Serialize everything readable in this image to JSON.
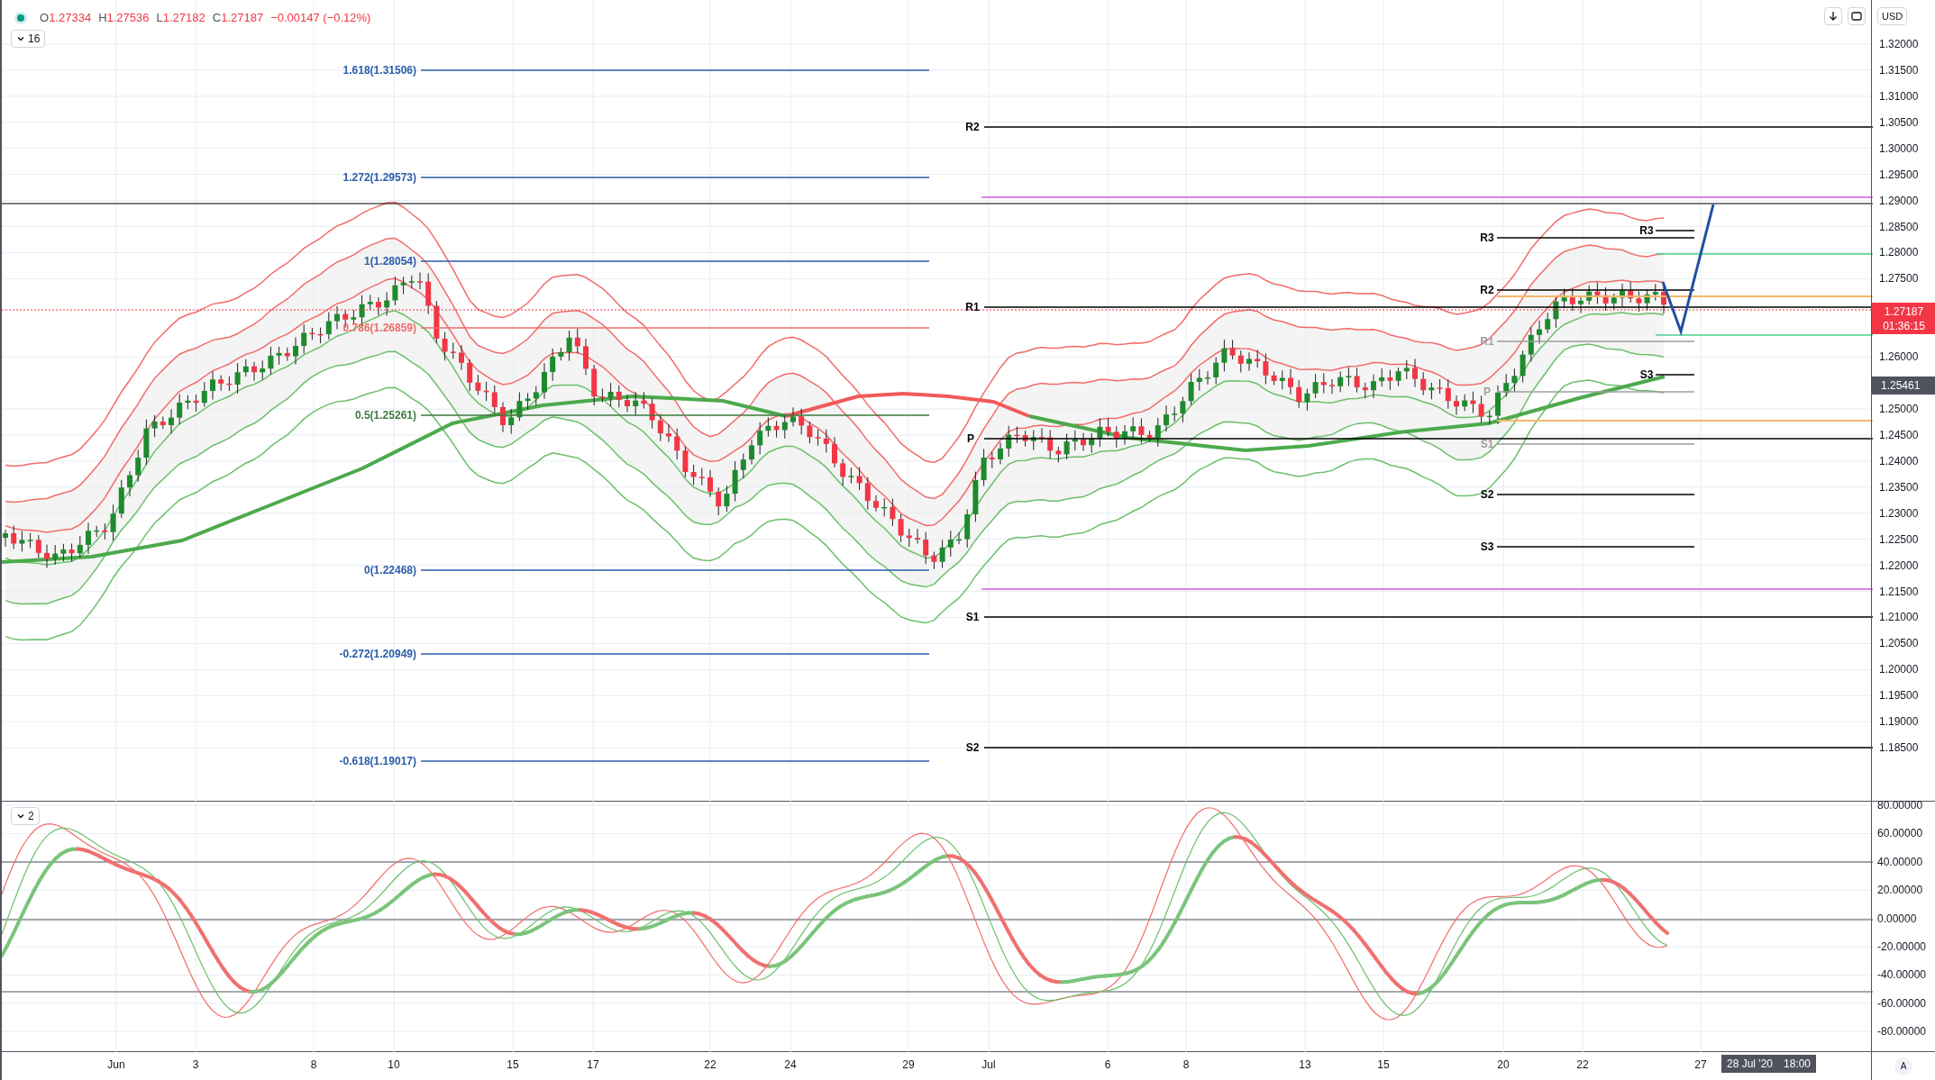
{
  "header": {
    "ohlc": [
      {
        "label": "O",
        "value": "1.27334"
      },
      {
        "label": "H",
        "value": "1.27536"
      },
      {
        "label": "L",
        "value": "1.27182"
      },
      {
        "label": "C",
        "value": "1.27187"
      }
    ],
    "change": "−0.00147 (−0.12%)"
  },
  "main_pane": {
    "collapse_count": "16"
  },
  "toolbar": {
    "currency": "USD"
  },
  "price_axis": {
    "ticks": [
      "1.32000",
      "1.31500",
      "1.31000",
      "1.30500",
      "1.30000",
      "1.29500",
      "1.29000",
      "1.28500",
      "1.28000",
      "1.27500",
      "1.26000",
      "1.25000",
      "1.24500",
      "1.24000",
      "1.23500",
      "1.23000",
      "1.22500",
      "1.22000",
      "1.21500",
      "1.21000",
      "1.20500",
      "1.20000",
      "1.19500",
      "1.19000",
      "1.18500"
    ],
    "last_price": "1.27187",
    "countdown": "01:36:15",
    "crosshair_price": "1.25461"
  },
  "fib_levels": [
    {
      "label": "1.618(1.31506)",
      "color": "#2a5caa"
    },
    {
      "label": "1.272(1.29573)",
      "color": "#2a5caa"
    },
    {
      "label": "1(1.28054)",
      "color": "#2a5caa"
    },
    {
      "label": "0.786(1.26859)",
      "color": "#f06a6a"
    },
    {
      "label": "0.5(1.25261)",
      "color": "#3e7a3e"
    },
    {
      "label": "0(1.22468)",
      "color": "#2a5caa"
    },
    {
      "label": "-0.272(1.20949)",
      "color": "#2a5caa"
    },
    {
      "label": "-0.618(1.19017)",
      "color": "#2a5caa"
    }
  ],
  "pivot_labels": [
    {
      "label": "R2",
      "color": "#000000"
    },
    {
      "label": "R1",
      "color": "#000000"
    },
    {
      "label": "P",
      "color": "#000000"
    },
    {
      "label": "S1",
      "color": "#000000"
    },
    {
      "label": "S2",
      "color": "#000000"
    },
    {
      "label": "R3",
      "color": "#000000"
    },
    {
      "label": "R2",
      "color": "#000000"
    },
    {
      "label": "R1",
      "color": "#9e9e9e"
    },
    {
      "label": "P",
      "color": "#9e9e9e"
    },
    {
      "label": "S1",
      "color": "#9e9e9e"
    },
    {
      "label": "S2",
      "color": "#000000"
    },
    {
      "label": "S3",
      "color": "#000000"
    },
    {
      "label": "R3",
      "color": "#000000"
    },
    {
      "label": "S3",
      "color": "#000000"
    }
  ],
  "oscillator_pane": {
    "collapse_count": "2",
    "ticks": [
      "80.00000",
      "60.00000",
      "40.00000",
      "20.00000",
      "0.00000",
      "-20.00000",
      "-40.00000",
      "-60.00000",
      "-80.00000"
    ]
  },
  "time_axis": {
    "labels": [
      "Jun",
      "3",
      "8",
      "10",
      "15",
      "17",
      "22",
      "24",
      "29",
      "Jul",
      "6",
      "8",
      "13",
      "15",
      "20",
      "22",
      "27"
    ],
    "cursor_date": "28 Jul '20",
    "cursor_time": "18:00",
    "auto_scale": "A"
  }
}
